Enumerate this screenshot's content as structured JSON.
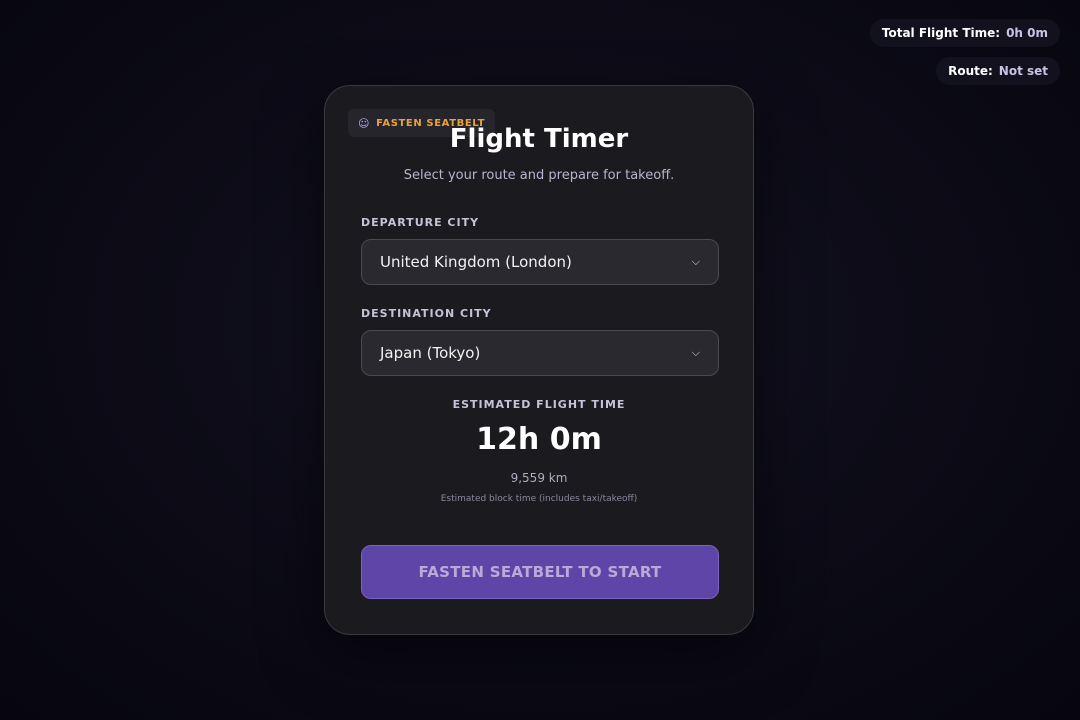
{
  "status": {
    "total_flight_time_label": "Total Flight Time:",
    "total_flight_time_value": "0h 0m",
    "route_label": "Route:",
    "route_value": "Not set"
  },
  "card": {
    "badge_icon": "person-seatbelt-icon",
    "badge_label": "FASTEN SEATBELT",
    "title": "Flight Timer",
    "subtitle": "Select your route and prepare for takeoff.",
    "departure_label": "DEPARTURE CITY",
    "departure_value": "United Kingdom (London)",
    "destination_label": "DESTINATION CITY",
    "destination_value": "Japan (Tokyo)",
    "estimate_label": "ESTIMATED FLIGHT TIME",
    "estimate_value": "12h 0m",
    "distance": "9,559 km",
    "estimate_note": "Estimated block time (includes taxi/takeoff)",
    "start_button": "FASTEN SEATBELT TO START"
  },
  "colors": {
    "accent": "#5e46a8",
    "badge_text": "#e8a43a",
    "card_bg": "#1c1b1f"
  }
}
